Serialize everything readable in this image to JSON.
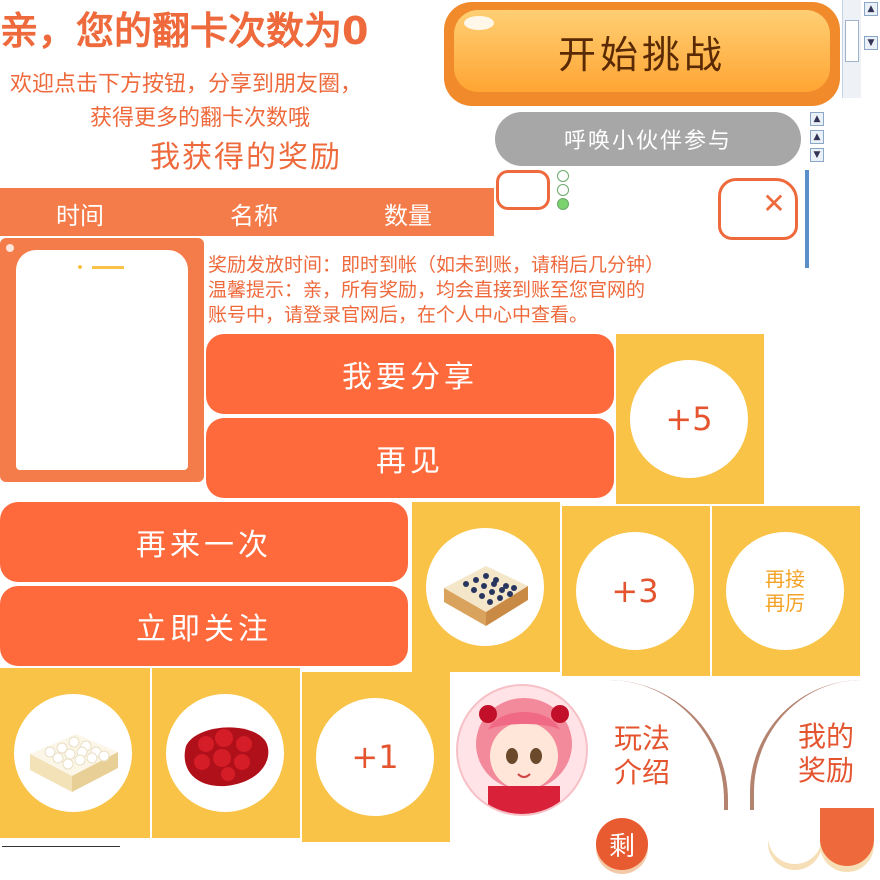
{
  "header": {
    "title": "亲，您的翻卡次数为0",
    "share_line1": "欢迎点击下方按钮，分享到朋友圈，",
    "share_line2": "获得更多的翻卡次数哦",
    "my_rewards_heading": "我获得的奖励"
  },
  "buttons": {
    "start": "开始挑战",
    "invite": "呼唤小伙伴参与",
    "share": "我要分享",
    "bye": "再见",
    "again": "再来一次",
    "follow": "立即关注"
  },
  "table": {
    "columns": [
      "时间",
      "名称",
      "数量"
    ]
  },
  "notice": {
    "line1": "奖励发放时间：即时到帐（如未到账，请稍后几分钟）",
    "line2": "温馨提示：亲，所有奖励，均会直接到账至您官网的",
    "line3": "账号中，请登录官网后，在个人中心中查看。"
  },
  "tiles": {
    "plus5": "+5",
    "plus3": "+3",
    "plus1": "+1",
    "retry": "再接再厉"
  },
  "side": {
    "gameplay": "玩法介绍",
    "my_rewards": "我的奖励",
    "remaining_badge": "剩"
  },
  "colors": {
    "accent": "#ff6a3d",
    "tile": "#f8c347",
    "text": "#ee6a3c"
  }
}
